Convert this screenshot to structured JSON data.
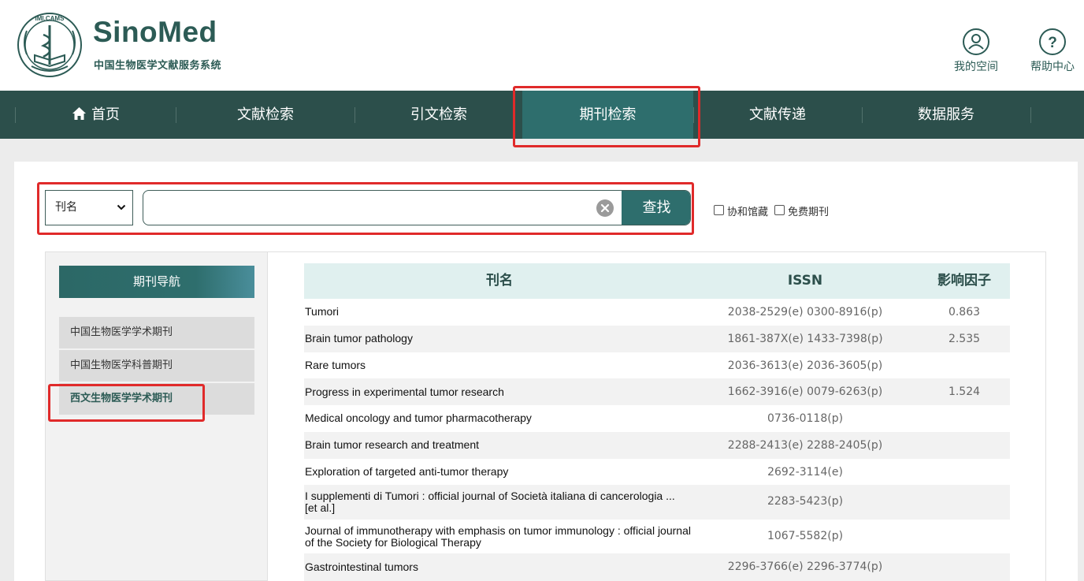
{
  "brand": {
    "name": "SinoMed",
    "subtitle": "中国生物医学文献服务系统",
    "logo_ring_text": "IMI.CAMS"
  },
  "top_links": {
    "space_label": "我的空间",
    "help_label": "帮助中心"
  },
  "nav": {
    "items": [
      {
        "label": "首页",
        "icon": "home-icon"
      },
      {
        "label": "文献检索"
      },
      {
        "label": "引文检索"
      },
      {
        "label": "期刊检索",
        "active": true
      },
      {
        "label": "文献传递"
      },
      {
        "label": "数据服务"
      }
    ]
  },
  "search": {
    "field_select": "刊名",
    "input_value": "",
    "button_label": "查找",
    "checkbox_1": "协和馆藏",
    "checkbox_2": "免费期刊"
  },
  "sidebar": {
    "header": "期刊导航",
    "items": [
      {
        "label": "中国生物医学学术期刊"
      },
      {
        "label": "中国生物医学科普期刊"
      },
      {
        "label": "西文生物医学学术期刊",
        "active": true
      }
    ]
  },
  "table": {
    "headers": {
      "name": "刊名",
      "issn": "ISSN",
      "if": "影响因子"
    },
    "rows": [
      {
        "name": "Tumori",
        "issn": "2038-2529(e) 0300-8916(p)",
        "if": "0.863"
      },
      {
        "name": "Brain tumor pathology",
        "issn": "1861-387X(e) 1433-7398(p)",
        "if": "2.535"
      },
      {
        "name": "Rare tumors",
        "issn": "2036-3613(e) 2036-3605(p)",
        "if": ""
      },
      {
        "name": "Progress in experimental tumor research",
        "issn": "1662-3916(e) 0079-6263(p)",
        "if": "1.524"
      },
      {
        "name": "Medical oncology and tumor pharmacotherapy",
        "issn": "0736-0118(p)",
        "if": ""
      },
      {
        "name": "Brain tumor research and treatment",
        "issn": "2288-2413(e) 2288-2405(p)",
        "if": ""
      },
      {
        "name": "Exploration of targeted anti-tumor therapy",
        "issn": "2692-3114(e)",
        "if": ""
      },
      {
        "name": "I supplementi di Tumori : official journal of Società italiana di cancerologia ... [et al.]",
        "issn": "2283-5423(p)",
        "if": ""
      },
      {
        "name": "Journal of immunotherapy with emphasis on tumor immunology : official journal of the Society for Biological Therapy",
        "issn": "1067-5582(p)",
        "if": ""
      },
      {
        "name": "Gastrointestinal tumors",
        "issn": "2296-3766(e) 2296-3774(p)",
        "if": ""
      }
    ]
  },
  "colors": {
    "brand": "#2c5b55",
    "nav_bg": "#2c4f4b",
    "nav_active": "#2e6e6d",
    "highlight_box": "#e02a2a",
    "table_header_bg": "#e0f0ef"
  }
}
